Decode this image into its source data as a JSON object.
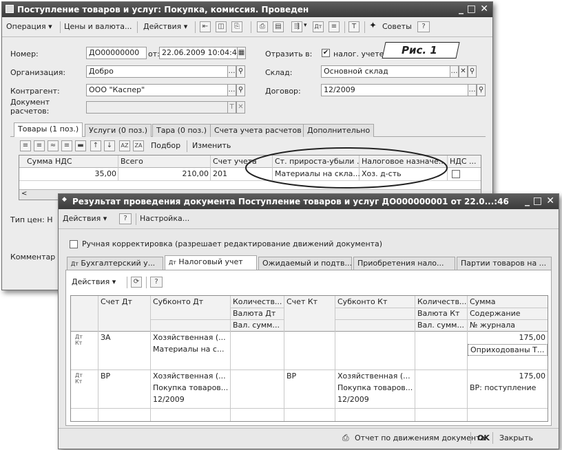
{
  "main_window": {
    "title": "Поступление товаров и услуг: Покупка, комиссия. Проведен",
    "toolbar": {
      "operation": "Операция ▾",
      "prices": "Цены и валюта...",
      "actions": "Действия ▾",
      "advice": "Советы",
      "help": "?"
    },
    "annotation": "Рис. 1",
    "fields": {
      "number_label": "Номер:",
      "number_value": "ДО00000000",
      "from_label": "от:",
      "date_value": "22.06.2009 10:04:48",
      "reflect_label": "Отразить в:",
      "tax_label": "налог. учете",
      "org_label": "Организация:",
      "org_value": "Добро",
      "warehouse_label": "Склад:",
      "warehouse_value": "Основной склад",
      "contractor_label": "Контрагент:",
      "contractor_value": "ООО \"Каспер\"",
      "contract_label": "Договор:",
      "contract_value": "12/2009",
      "settlement_label_1": "Документ",
      "settlement_label_2": "расчетов:"
    },
    "tabs": [
      "Товары (1 поз.)",
      "Услуги (0 поз.)",
      "Тара (0 поз.)",
      "Счета учета расчетов",
      "Дополнительно"
    ],
    "grid_toolbar": {
      "pick": "Подбор",
      "change": "Изменить"
    },
    "grid": {
      "headers": [
        "Сумма НДС",
        "Всего",
        "Счет учета",
        "Ст. прироста-убыли ...",
        "Налоговое назначе...",
        "НДС ..."
      ],
      "row": [
        "35,00",
        "210,00",
        "201",
        "Материалы на скла...",
        "Хоз. д-сть",
        ""
      ]
    },
    "price_type": "Тип цен: Н",
    "comment": "Комментар"
  },
  "result_window": {
    "title": "Результат проведения документа Поступление товаров и услуг ДО000000001 от 22.0...:46",
    "toolbar": {
      "actions": "Действия ▾",
      "help": "?",
      "settings": "Настройка..."
    },
    "manual_label": "Ручная корректировка (разрешает редактирование движений документа)",
    "tabs": [
      "Бухгалтерский у...",
      "Налоговый учет",
      "Ожидаемый и подтв...",
      "Приобретения нало...",
      "Партии товаров на ..."
    ],
    "inner_toolbar": {
      "actions": "Действия ▾",
      "help": "?"
    },
    "headers": {
      "debit_account": "Счет Дт",
      "debit_subconto": "Субконто Дт",
      "debit_qty": "Количеств...",
      "debit_currency": "Валюта Дт",
      "debit_curr_sum": "Вал. сумм...",
      "credit_account": "Счет Кт",
      "credit_subconto": "Субконто Кт",
      "credit_qty": "Количеств...",
      "credit_currency": "Валюта Кт",
      "credit_curr_sum": "Вал. сумм...",
      "sum": "Сумма",
      "content": "Содержание",
      "journal": "№ журнала"
    },
    "rows": [
      {
        "debit_account": "ЗА",
        "debit_sub1": "Хозяйственная (...",
        "debit_sub2": "Материалы на с...",
        "debit_sub3": "",
        "credit_account": "",
        "credit_sub1": "",
        "credit_sub2": "",
        "credit_sub3": "",
        "sum": "175,00",
        "content": "Оприходованы Т..."
      },
      {
        "debit_account": "ВР",
        "debit_sub1": "Хозяйственная (...",
        "debit_sub2": "Покупка товаров...",
        "debit_sub3": "12/2009",
        "credit_account": "ВР",
        "credit_sub1": "Хозяйственная (...",
        "credit_sub2": "Покупка товаров...",
        "credit_sub3": "12/2009",
        "sum": "175,00",
        "content": "ВР: поступление"
      }
    ],
    "footer": {
      "report": "Отчет по движениям документа",
      "ok": "OK",
      "close": "Закрыть"
    }
  }
}
